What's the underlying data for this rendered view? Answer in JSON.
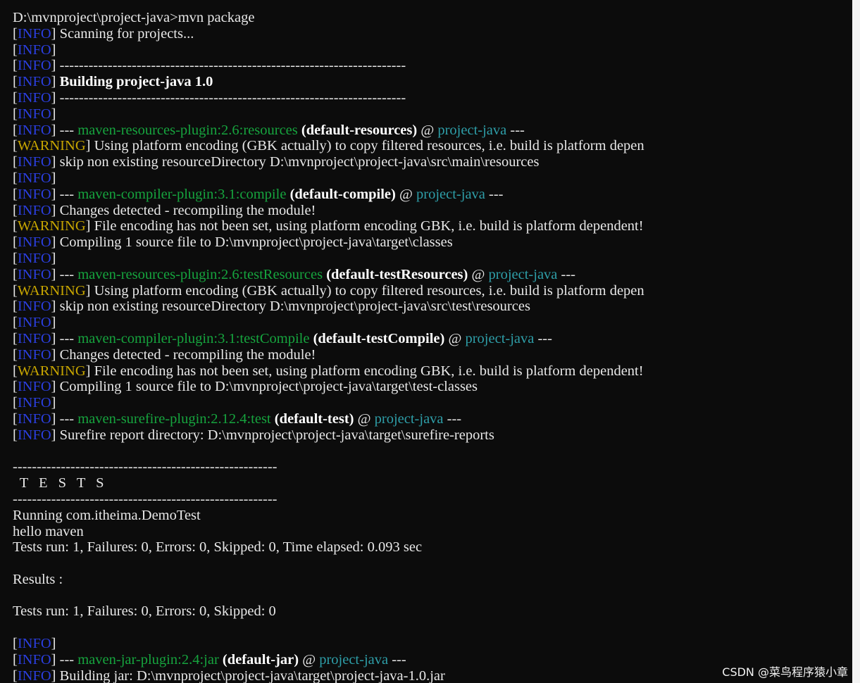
{
  "console": {
    "lines": [
      {
        "kind": "prompt",
        "text": "D:\\mvnproject\\project-java>mvn package"
      },
      {
        "kind": "log",
        "level": "INFO",
        "message": " Scanning for projects..."
      },
      {
        "kind": "log",
        "level": "INFO",
        "message": ""
      },
      {
        "kind": "log",
        "level": "INFO",
        "message": " ------------------------------------------------------------------------"
      },
      {
        "kind": "log",
        "level": "INFO",
        "message": " Building project-java 1.0",
        "bold": true
      },
      {
        "kind": "log",
        "level": "INFO",
        "message": " ------------------------------------------------------------------------"
      },
      {
        "kind": "log",
        "level": "INFO",
        "message": ""
      },
      {
        "kind": "plugin",
        "level": "INFO",
        "plugin": "maven-resources-plugin:2.6:resources",
        "execution": "(default-resources)",
        "project": "project-java"
      },
      {
        "kind": "log",
        "level": "WARNING",
        "message": " Using platform encoding (GBK actually) to copy filtered resources, i.e. build is platform depen"
      },
      {
        "kind": "log",
        "level": "INFO",
        "message": " skip non existing resourceDirectory D:\\mvnproject\\project-java\\src\\main\\resources"
      },
      {
        "kind": "log",
        "level": "INFO",
        "message": ""
      },
      {
        "kind": "plugin",
        "level": "INFO",
        "plugin": "maven-compiler-plugin:3.1:compile",
        "execution": "(default-compile)",
        "project": "project-java"
      },
      {
        "kind": "log",
        "level": "INFO",
        "message": " Changes detected - recompiling the module!"
      },
      {
        "kind": "log",
        "level": "WARNING",
        "message": " File encoding has not been set, using platform encoding GBK, i.e. build is platform dependent!"
      },
      {
        "kind": "log",
        "level": "INFO",
        "message": " Compiling 1 source file to D:\\mvnproject\\project-java\\target\\classes"
      },
      {
        "kind": "log",
        "level": "INFO",
        "message": ""
      },
      {
        "kind": "plugin",
        "level": "INFO",
        "plugin": "maven-resources-plugin:2.6:testResources",
        "execution": "(default-testResources)",
        "project": "project-java"
      },
      {
        "kind": "log",
        "level": "WARNING",
        "message": " Using platform encoding (GBK actually) to copy filtered resources, i.e. build is platform depen"
      },
      {
        "kind": "log",
        "level": "INFO",
        "message": " skip non existing resourceDirectory D:\\mvnproject\\project-java\\src\\test\\resources"
      },
      {
        "kind": "log",
        "level": "INFO",
        "message": ""
      },
      {
        "kind": "plugin",
        "level": "INFO",
        "plugin": "maven-compiler-plugin:3.1:testCompile",
        "execution": "(default-testCompile)",
        "project": "project-java"
      },
      {
        "kind": "log",
        "level": "INFO",
        "message": " Changes detected - recompiling the module!"
      },
      {
        "kind": "log",
        "level": "WARNING",
        "message": " File encoding has not been set, using platform encoding GBK, i.e. build is platform dependent!"
      },
      {
        "kind": "log",
        "level": "INFO",
        "message": " Compiling 1 source file to D:\\mvnproject\\project-java\\target\\test-classes"
      },
      {
        "kind": "log",
        "level": "INFO",
        "message": ""
      },
      {
        "kind": "plugin",
        "level": "INFO",
        "plugin": "maven-surefire-plugin:2.12.4:test",
        "execution": "(default-test)",
        "project": "project-java"
      },
      {
        "kind": "log",
        "level": "INFO",
        "message": " Surefire report directory: D:\\mvnproject\\project-java\\target\\surefire-reports"
      },
      {
        "kind": "text",
        "text": ""
      },
      {
        "kind": "text",
        "text": "-------------------------------------------------------"
      },
      {
        "kind": "tests-title",
        "text": " T E S T S"
      },
      {
        "kind": "text",
        "text": "-------------------------------------------------------"
      },
      {
        "kind": "text",
        "text": "Running com.itheima.DemoTest"
      },
      {
        "kind": "text",
        "text": "hello maven"
      },
      {
        "kind": "text",
        "text": "Tests run: 1, Failures: 0, Errors: 0, Skipped: 0, Time elapsed: 0.093 sec"
      },
      {
        "kind": "text",
        "text": ""
      },
      {
        "kind": "text",
        "text": "Results :"
      },
      {
        "kind": "text",
        "text": ""
      },
      {
        "kind": "text",
        "text": "Tests run: 1, Failures: 0, Errors: 0, Skipped: 0"
      },
      {
        "kind": "text",
        "text": ""
      },
      {
        "kind": "log",
        "level": "INFO",
        "message": ""
      },
      {
        "kind": "plugin",
        "level": "INFO",
        "plugin": "maven-jar-plugin:2.4:jar",
        "execution": "(default-jar)",
        "project": "project-java"
      },
      {
        "kind": "log",
        "level": "INFO",
        "message": " Building jar: D:\\mvnproject\\project-java\\target\\project-java-1.0.jar"
      }
    ],
    "tokens": {
      "plugin_prefix": " --- ",
      "plugin_suffix": " ---",
      "at_sign": " @ "
    },
    "colors": {
      "background": "#0c0c0c",
      "text": "#e8e8e8",
      "info": "#2b3fe0",
      "warning": "#c7a500",
      "plugin": "#16a43e",
      "project": "#2e9ea8"
    }
  },
  "watermark": {
    "text": "CSDN @菜鸟程序猿小章"
  }
}
